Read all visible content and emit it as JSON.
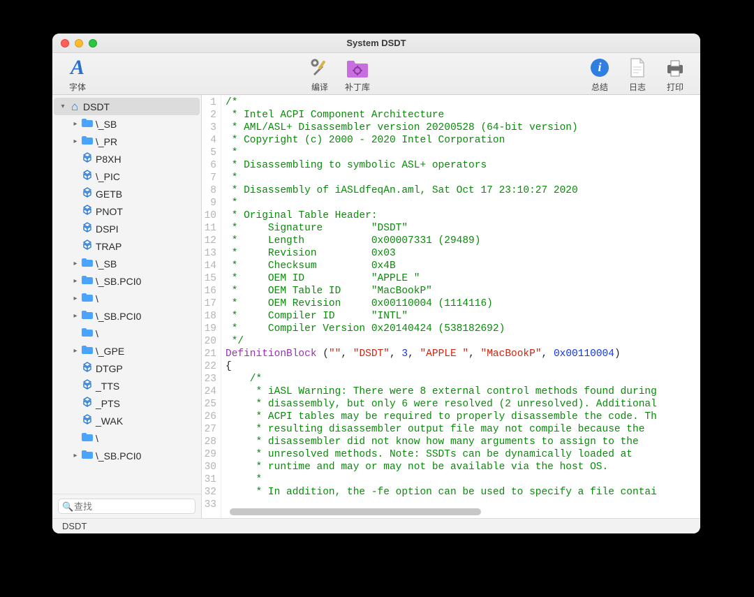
{
  "window": {
    "title": "System DSDT"
  },
  "toolbar": {
    "font": "字体",
    "compile": "编译",
    "patches": "补丁库",
    "summary": "总结",
    "log": "日志",
    "print": "打印"
  },
  "sidebar": {
    "search_placeholder": "查找",
    "items": [
      {
        "label": "DSDT",
        "icon": "home",
        "indent": 0,
        "chev": "down",
        "sel": true
      },
      {
        "label": "\\_SB",
        "icon": "folder",
        "indent": 1,
        "chev": "right"
      },
      {
        "label": "\\_PR",
        "icon": "folder",
        "indent": 1,
        "chev": "right"
      },
      {
        "label": "P8XH",
        "icon": "method",
        "indent": 1
      },
      {
        "label": "\\_PIC",
        "icon": "method",
        "indent": 1
      },
      {
        "label": "GETB",
        "icon": "method",
        "indent": 1
      },
      {
        "label": "PNOT",
        "icon": "method",
        "indent": 1
      },
      {
        "label": "DSPI",
        "icon": "method",
        "indent": 1
      },
      {
        "label": "TRAP",
        "icon": "method",
        "indent": 1
      },
      {
        "label": "\\_SB",
        "icon": "folder",
        "indent": 1,
        "chev": "right"
      },
      {
        "label": "\\_SB.PCI0",
        "icon": "folder",
        "indent": 1,
        "chev": "right"
      },
      {
        "label": "\\",
        "icon": "folder",
        "indent": 1,
        "chev": "right"
      },
      {
        "label": "\\_SB.PCI0",
        "icon": "folder",
        "indent": 1,
        "chev": "right"
      },
      {
        "label": "\\",
        "icon": "folder",
        "indent": 1
      },
      {
        "label": "\\_GPE",
        "icon": "folder",
        "indent": 1,
        "chev": "right"
      },
      {
        "label": "DTGP",
        "icon": "method",
        "indent": 1
      },
      {
        "label": "_TTS",
        "icon": "method",
        "indent": 1
      },
      {
        "label": "_PTS",
        "icon": "method",
        "indent": 1
      },
      {
        "label": "_WAK",
        "icon": "method",
        "indent": 1
      },
      {
        "label": "\\",
        "icon": "folder",
        "indent": 1
      },
      {
        "label": "\\_SB.PCI0",
        "icon": "folder",
        "indent": 1,
        "chev": "right"
      }
    ]
  },
  "status": {
    "path": "DSDT"
  },
  "code": {
    "lines": [
      {
        "n": 1,
        "spans": [
          {
            "t": "/*",
            "c": "com"
          }
        ]
      },
      {
        "n": 2,
        "spans": [
          {
            "t": " * Intel ACPI Component Architecture",
            "c": "com"
          }
        ]
      },
      {
        "n": 3,
        "spans": [
          {
            "t": " * AML/ASL+ Disassembler version 20200528 (64-bit version)",
            "c": "com"
          }
        ]
      },
      {
        "n": 4,
        "spans": [
          {
            "t": " * Copyright (c) 2000 - 2020 Intel Corporation",
            "c": "com"
          }
        ]
      },
      {
        "n": 5,
        "spans": [
          {
            "t": " *",
            "c": "com"
          }
        ]
      },
      {
        "n": 6,
        "spans": [
          {
            "t": " * Disassembling to symbolic ASL+ operators",
            "c": "com"
          }
        ]
      },
      {
        "n": 7,
        "spans": [
          {
            "t": " *",
            "c": "com"
          }
        ]
      },
      {
        "n": 8,
        "spans": [
          {
            "t": " * Disassembly of iASLdfeqAn.aml, Sat Oct 17 23:10:27 2020",
            "c": "com"
          }
        ]
      },
      {
        "n": 9,
        "spans": [
          {
            "t": " *",
            "c": "com"
          }
        ]
      },
      {
        "n": 10,
        "spans": [
          {
            "t": " * Original Table Header:",
            "c": "com"
          }
        ]
      },
      {
        "n": 11,
        "spans": [
          {
            "t": " *     Signature        \"DSDT\"",
            "c": "com"
          }
        ]
      },
      {
        "n": 12,
        "spans": [
          {
            "t": " *     Length           0x00007331 (29489)",
            "c": "com"
          }
        ]
      },
      {
        "n": 13,
        "spans": [
          {
            "t": " *     Revision         0x03",
            "c": "com"
          }
        ]
      },
      {
        "n": 14,
        "spans": [
          {
            "t": " *     Checksum         0x4B",
            "c": "com"
          }
        ]
      },
      {
        "n": 15,
        "spans": [
          {
            "t": " *     OEM ID           \"APPLE \"",
            "c": "com"
          }
        ]
      },
      {
        "n": 16,
        "spans": [
          {
            "t": " *     OEM Table ID     \"MacBookP\"",
            "c": "com"
          }
        ]
      },
      {
        "n": 17,
        "spans": [
          {
            "t": " *     OEM Revision     0x00110004 (1114116)",
            "c": "com"
          }
        ]
      },
      {
        "n": 18,
        "spans": [
          {
            "t": " *     Compiler ID      \"INTL\"",
            "c": "com"
          }
        ]
      },
      {
        "n": 19,
        "spans": [
          {
            "t": " *     Compiler Version 0x20140424 (538182692)",
            "c": "com"
          }
        ]
      },
      {
        "n": 20,
        "spans": [
          {
            "t": " */",
            "c": "com"
          }
        ]
      },
      {
        "n": 21,
        "spans": [
          {
            "t": "DefinitionBlock ",
            "c": "kw"
          },
          {
            "t": "(",
            "c": "pl"
          },
          {
            "t": "\"\"",
            "c": "str"
          },
          {
            "t": ", ",
            "c": "pl"
          },
          {
            "t": "\"DSDT\"",
            "c": "str"
          },
          {
            "t": ", ",
            "c": "pl"
          },
          {
            "t": "3",
            "c": "num"
          },
          {
            "t": ", ",
            "c": "pl"
          },
          {
            "t": "\"APPLE \"",
            "c": "str"
          },
          {
            "t": ", ",
            "c": "pl"
          },
          {
            "t": "\"MacBookP\"",
            "c": "str"
          },
          {
            "t": ", ",
            "c": "pl"
          },
          {
            "t": "0x00110004",
            "c": "num"
          },
          {
            "t": ")",
            "c": "pl"
          }
        ]
      },
      {
        "n": 22,
        "spans": [
          {
            "t": "{",
            "c": "pl"
          }
        ]
      },
      {
        "n": 23,
        "spans": [
          {
            "t": "    /*",
            "c": "com"
          }
        ]
      },
      {
        "n": 24,
        "spans": [
          {
            "t": "     * iASL Warning: There were 8 external control methods found during",
            "c": "com"
          }
        ]
      },
      {
        "n": 25,
        "spans": [
          {
            "t": "     * disassembly, but only 6 were resolved (2 unresolved). Additional",
            "c": "com"
          }
        ]
      },
      {
        "n": 26,
        "spans": [
          {
            "t": "     * ACPI tables may be required to properly disassemble the code. Th",
            "c": "com"
          }
        ]
      },
      {
        "n": 27,
        "spans": [
          {
            "t": "     * resulting disassembler output file may not compile because the",
            "c": "com"
          }
        ]
      },
      {
        "n": 28,
        "spans": [
          {
            "t": "     * disassembler did not know how many arguments to assign to the",
            "c": "com"
          }
        ]
      },
      {
        "n": 29,
        "spans": [
          {
            "t": "     * unresolved methods. Note: SSDTs can be dynamically loaded at",
            "c": "com"
          }
        ]
      },
      {
        "n": 30,
        "spans": [
          {
            "t": "     * runtime and may or may not be available via the host OS.",
            "c": "com"
          }
        ]
      },
      {
        "n": 31,
        "spans": [
          {
            "t": "     *",
            "c": "com"
          }
        ]
      },
      {
        "n": 32,
        "spans": [
          {
            "t": "     * In addition, the -fe option can be used to specify a file contai",
            "c": "com"
          }
        ]
      },
      {
        "n": 33,
        "spans": [
          {
            "t": "",
            "c": "pl"
          }
        ]
      }
    ]
  }
}
